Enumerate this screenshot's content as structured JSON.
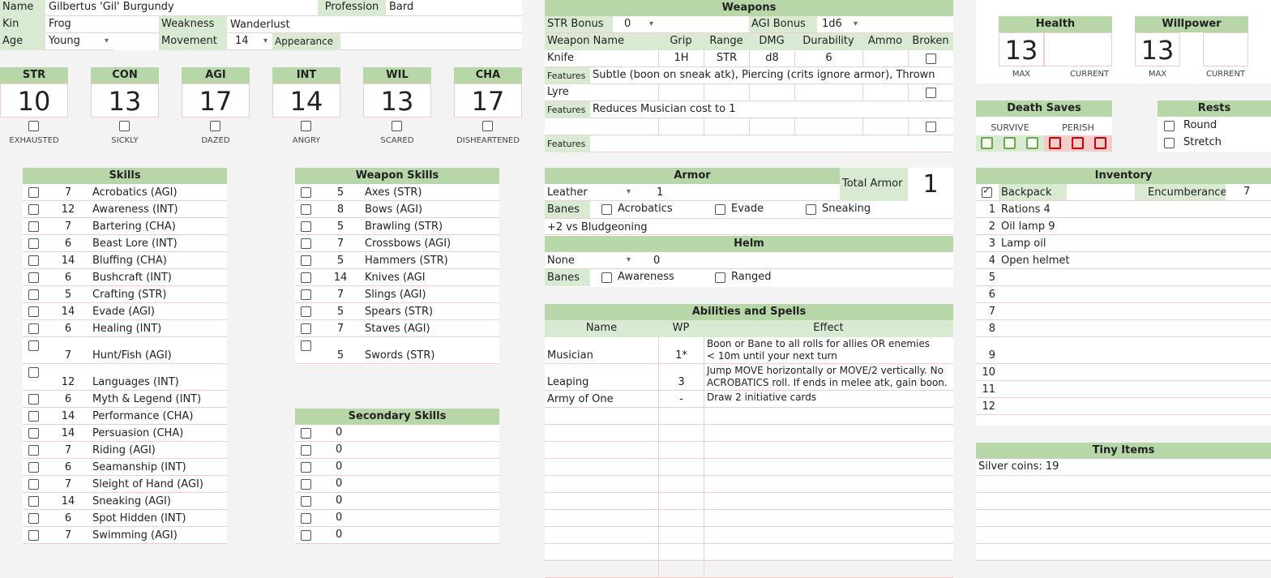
{
  "char": {
    "name_label": "Name",
    "name": "Gilbertus 'Gil' Burgundy",
    "profession_label": "Profession",
    "profession": "Bard",
    "kin_label": "Kin",
    "kin": "Frog",
    "weakness_label": "Weakness",
    "weakness": "Wanderlust",
    "age_label": "Age",
    "age": "Young",
    "movement_label": "Movement",
    "movement": "14",
    "appearance_label": "Appearance"
  },
  "attributes": [
    {
      "abbr": "STR",
      "value": "10",
      "condition": "EXHAUSTED"
    },
    {
      "abbr": "CON",
      "value": "13",
      "condition": "SICKLY"
    },
    {
      "abbr": "AGI",
      "value": "17",
      "condition": "DAZED"
    },
    {
      "abbr": "INT",
      "value": "14",
      "condition": "ANGRY"
    },
    {
      "abbr": "WIL",
      "value": "13",
      "condition": "SCARED"
    },
    {
      "abbr": "CHA",
      "value": "17",
      "condition": "DISHEARTENED"
    }
  ],
  "skills": {
    "title": "Skills",
    "items": [
      {
        "v": "7",
        "n": "Acrobatics (AGI)"
      },
      {
        "v": "12",
        "n": "Awareness (INT)"
      },
      {
        "v": "7",
        "n": "Bartering (CHA)"
      },
      {
        "v": "6",
        "n": "Beast Lore (INT)"
      },
      {
        "v": "14",
        "n": "Bluffing (CHA)"
      },
      {
        "v": "6",
        "n": "Bushcraft (INT)"
      },
      {
        "v": "5",
        "n": "Crafting (STR)"
      },
      {
        "v": "14",
        "n": "Evade (AGI)"
      },
      {
        "v": "6",
        "n": "Healing (INT)"
      },
      {
        "v": "7",
        "n": "Hunt/Fish (AGI)"
      },
      {
        "v": "12",
        "n": "Languages (INT)"
      },
      {
        "v": "6",
        "n": "Myth & Legend (INT)"
      },
      {
        "v": "14",
        "n": "Performance (CHA)"
      },
      {
        "v": "14",
        "n": "Persuasion (CHA)"
      },
      {
        "v": "7",
        "n": "Riding (AGI)"
      },
      {
        "v": "6",
        "n": "Seamanship (INT)"
      },
      {
        "v": "7",
        "n": "Sleight of Hand (AGI)"
      },
      {
        "v": "14",
        "n": "Sneaking (AGI)"
      },
      {
        "v": "6",
        "n": "Spot Hidden (INT)"
      },
      {
        "v": "7",
        "n": "Swimming (AGI)"
      }
    ]
  },
  "weapon_skills": {
    "title": "Weapon Skills",
    "items": [
      {
        "v": "5",
        "n": "Axes (STR)"
      },
      {
        "v": "8",
        "n": "Bows (AGI)"
      },
      {
        "v": "5",
        "n": "Brawling (STR)"
      },
      {
        "v": "7",
        "n": "Crossbows (AGI)"
      },
      {
        "v": "5",
        "n": "Hammers (STR)"
      },
      {
        "v": "14",
        "n": "Knives (AGI"
      },
      {
        "v": "7",
        "n": "Slings (AGI)"
      },
      {
        "v": "5",
        "n": "Spears (STR)"
      },
      {
        "v": "7",
        "n": "Staves (AGI)"
      },
      {
        "v": "5",
        "n": "Swords (STR)"
      }
    ]
  },
  "secondary_skills": {
    "title": "Secondary Skills",
    "items": [
      "0",
      "0",
      "0",
      "0",
      "0",
      "0",
      "0"
    ]
  },
  "weapons": {
    "title": "Weapons",
    "str_bonus_label": "STR Bonus",
    "str_bonus": "0",
    "agi_bonus_label": "AGI Bonus",
    "agi_bonus": "1d6",
    "cols": [
      "Weapon Name",
      "Grip",
      "Range",
      "DMG",
      "Durability",
      "Ammo",
      "Broken"
    ],
    "features_label": "Features",
    "rows": [
      {
        "name": "Knife",
        "grip": "1H",
        "range": "STR",
        "dmg": "d8",
        "dur": "6",
        "ammo": "",
        "features": "Subtle (boon on sneak atk), Piercing (crits ignore armor), Thrown"
      },
      {
        "name": "Lyre",
        "grip": "",
        "range": "",
        "dmg": "",
        "dur": "",
        "ammo": "",
        "features": "Reduces Musician cost to 1"
      },
      {
        "name": "",
        "grip": "",
        "range": "",
        "dmg": "",
        "dur": "",
        "ammo": "",
        "features": ""
      }
    ]
  },
  "armor": {
    "title": "Armor",
    "type": "Leather",
    "rating": "1",
    "total_label": "Total Armor",
    "total": "1",
    "banes_label": "Banes",
    "banes": [
      "Acrobatics",
      "Evade",
      "Sneaking"
    ],
    "note": "+2 vs Bludgeoning"
  },
  "helm": {
    "title": "Helm",
    "type": "None",
    "rating": "0",
    "banes_label": "Banes",
    "banes": [
      "Awareness",
      "Ranged"
    ]
  },
  "abilities": {
    "title": "Abilities and Spells",
    "cols": [
      "Name",
      "WP",
      "Effect"
    ],
    "rows": [
      {
        "name": "Musician",
        "wp": "1*",
        "effect1": "Boon or Bane to all rolls for allies OR enemies",
        "effect2": "< 10m until your next turn"
      },
      {
        "name": "Leaping",
        "wp": "3",
        "effect1": "Jump MOVE horizontally or MOVE/2 vertically. No",
        "effect2": "ACROBATICS roll. If ends in melee atk, gain boon."
      },
      {
        "name": "Army of One",
        "wp": "-",
        "effect1": "Draw 2 initiative cards",
        "effect2": ""
      }
    ]
  },
  "health": {
    "title": "Health",
    "max": "13",
    "max_label": "MAX",
    "current_label": "CURRENT"
  },
  "willpower": {
    "title": "Willpower",
    "max": "13",
    "max_label": "MAX",
    "current_label": "CURRENT"
  },
  "death_saves": {
    "title": "Death Saves",
    "survive": "SURVIVE",
    "perish": "PERISH"
  },
  "rests": {
    "title": "Rests",
    "items": [
      "Round",
      "Stretch"
    ]
  },
  "inventory": {
    "title": "Inventory",
    "backpack": "Backpack",
    "enc_label": "Encumberance",
    "enc": "7",
    "items": [
      {
        "n": "1",
        "t": "Rations 4"
      },
      {
        "n": "2",
        "t": "Oil lamp 9"
      },
      {
        "n": "3",
        "t": "Lamp oil"
      },
      {
        "n": "4",
        "t": "Open helmet"
      },
      {
        "n": "5",
        "t": ""
      },
      {
        "n": "6",
        "t": ""
      },
      {
        "n": "7",
        "t": ""
      },
      {
        "n": "8",
        "t": ""
      },
      {
        "n": "9",
        "t": ""
      },
      {
        "n": "10",
        "t": ""
      },
      {
        "n": "11",
        "t": ""
      },
      {
        "n": "12",
        "t": ""
      }
    ]
  },
  "tiny": {
    "title": "Tiny Items",
    "items": [
      "Silver coins: 19"
    ]
  }
}
